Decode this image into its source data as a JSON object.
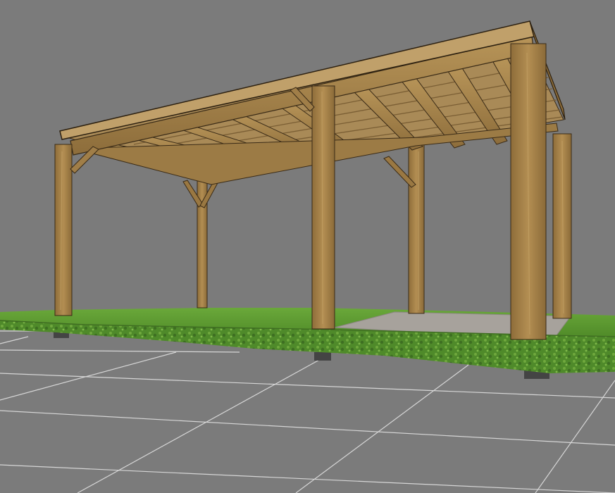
{
  "scene": {
    "background_color": "#7b7b7b",
    "floor_color": "#7a7a7a",
    "grid_line_color": "#d6d6d6",
    "grass_color": "#5e9a2f",
    "grass_edge_color": "#3f6d22",
    "concrete_pad_color": "#a7a29c",
    "wood_light": "#b08a4d",
    "wood_mid": "#9a7842",
    "wood_dark": "#6d5530",
    "wood_outline": "#3a2b17",
    "footing_color": "#444444"
  },
  "objects": {
    "structure": "timber-carport-pergola",
    "posts_visible": 6,
    "roof_battens": true,
    "knee_braces": true,
    "base": "grass-platform-with-concrete-pad"
  }
}
